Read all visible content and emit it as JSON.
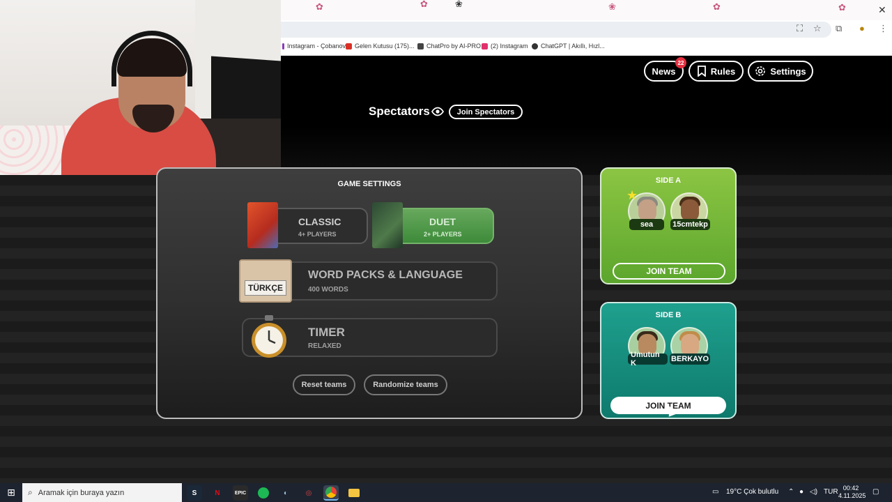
{
  "browser": {
    "bookmarks": [
      {
        "label": "Instagram - Çobanov",
        "color": "#8a3ab9"
      },
      {
        "label": "Gelen Kutusu (175)...",
        "color": "#d93025"
      },
      {
        "label": "ChatPro by AI-PRO",
        "color": "#444444"
      },
      {
        "label": "(2) Instagram",
        "color": "#e1306c"
      },
      {
        "label": "ChatGPT | Akıllı, Hızl...",
        "color": "#333333"
      }
    ]
  },
  "header": {
    "news_label": "News",
    "news_badge": "22",
    "rules_label": "Rules",
    "settings_label": "Settings"
  },
  "spectators": {
    "title": "Spectators",
    "join_label": "Join Spectators"
  },
  "game_settings": {
    "title": "GAME SETTINGS",
    "modes": [
      {
        "name": "CLASSIC",
        "players": "4+ PLAYERS",
        "selected": false
      },
      {
        "name": "DUET",
        "players": "2+ PLAYERS",
        "selected": true
      }
    ],
    "word_packs": {
      "title": "WORD PACKS & LANGUAGE",
      "subtitle": "400 WORDS",
      "language": "TÜRKÇE"
    },
    "timer": {
      "title": "TIMER",
      "subtitle": "RELAXED"
    },
    "reset_label": "Reset teams",
    "randomize_label": "Randomize teams"
  },
  "teams": [
    {
      "title": "SIDE A",
      "players": [
        "sea",
        "15cmtekp"
      ],
      "join_label": "JOIN TEAM",
      "color": "#7dbb3c"
    },
    {
      "title": "SIDE B",
      "players": [
        "Umutun K",
        "BERKAYO"
      ],
      "join_label": "JOIN TEAM",
      "color": "#14907f"
    }
  ],
  "taskbar": {
    "search_placeholder": "Aramak için buraya yazın",
    "weather": "19°C  Çok bulutlu",
    "language": "TUR",
    "time": "00:42",
    "date": "4.11.2025"
  }
}
